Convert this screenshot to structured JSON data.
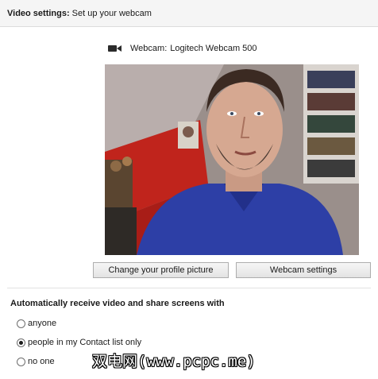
{
  "header": {
    "label": "Video settings:",
    "subtitle": "Set up your webcam"
  },
  "webcam": {
    "icon": "video-camera-icon",
    "label": "Webcam:",
    "device": "Logitech Webcam 500"
  },
  "preview": {
    "description_icon": "webcam-preview-image"
  },
  "buttons": {
    "profile_picture": "Change your profile picture",
    "webcam_settings": "Webcam settings"
  },
  "sharing": {
    "title": "Automatically receive video and share screens with",
    "options": [
      {
        "label": "anyone",
        "selected": false
      },
      {
        "label": "people in my Contact list only",
        "selected": true
      },
      {
        "label": "no one",
        "selected": false
      }
    ]
  },
  "watermark": "双电网(www.pcpc.me)",
  "colors": {
    "header_bg": "#f5f5f5",
    "button_border": "#adadad",
    "wall_red": "#c0241c",
    "shirt_blue": "#2d3fa6"
  }
}
